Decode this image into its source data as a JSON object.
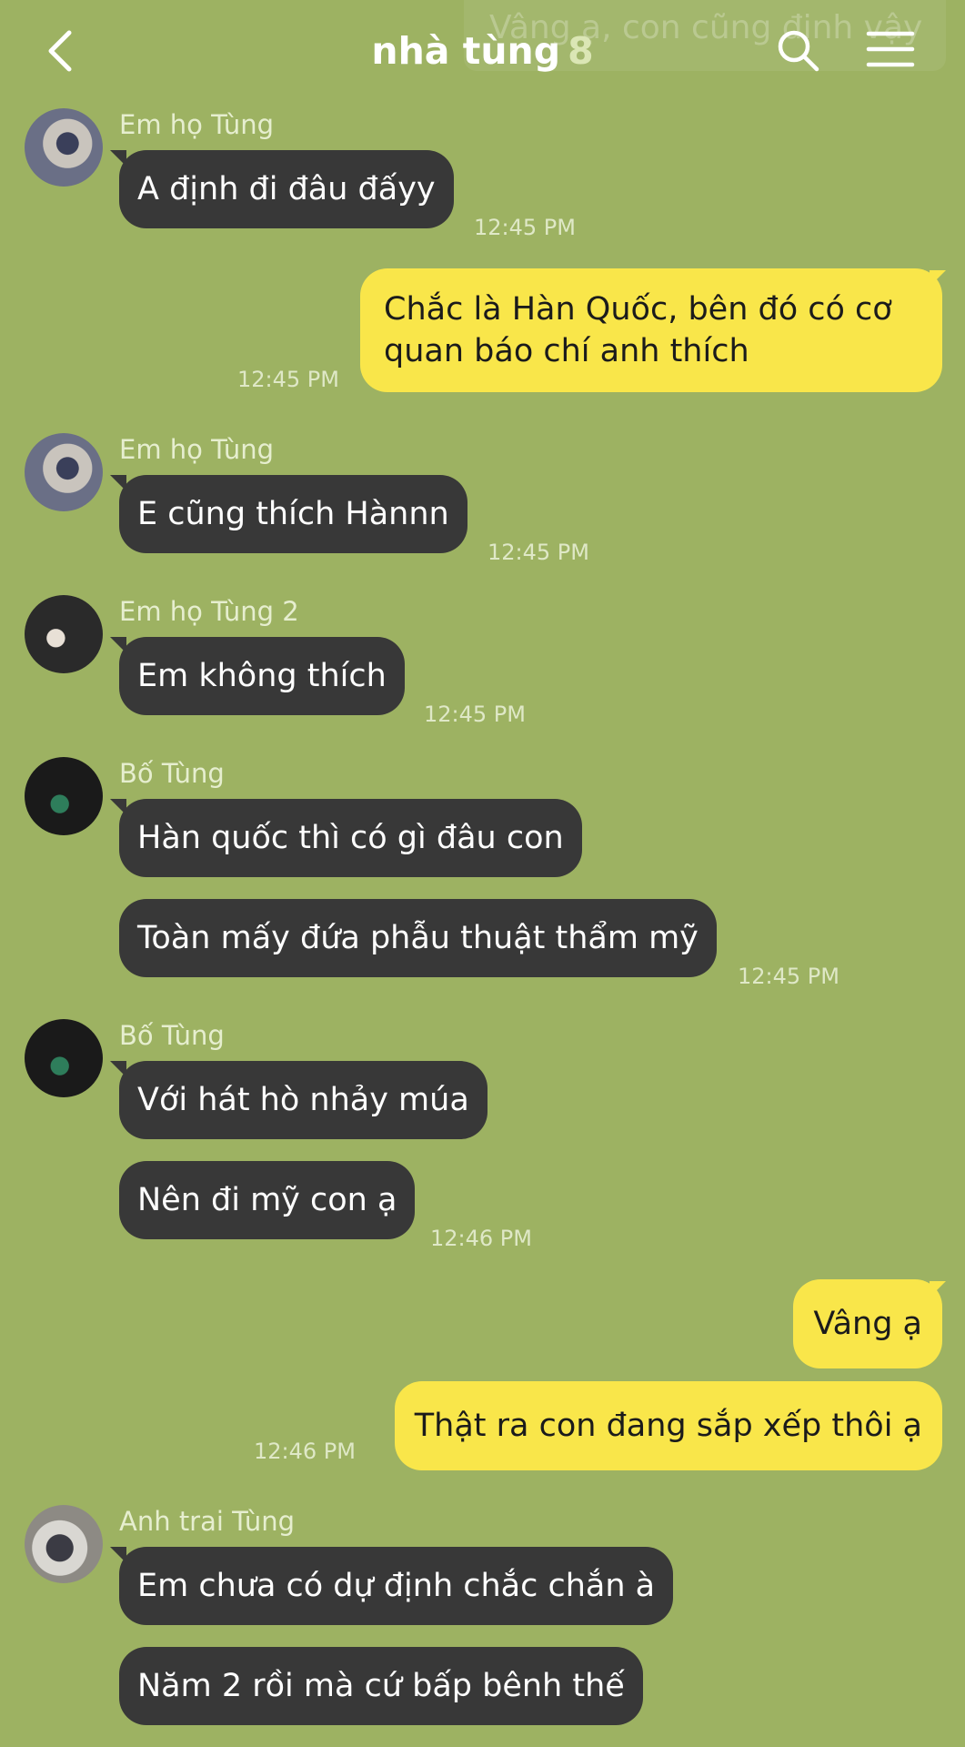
{
  "header": {
    "title": "nhà tùng",
    "member_count": "8",
    "notification_preview": "Vâng ạ, con cũng định vậy"
  },
  "messages": [
    {
      "sender": "Em họ Tùng",
      "text": "A định đi đâu đấyy",
      "time": "12:45 PM"
    },
    {
      "text": "Chắc là Hàn Quốc, bên đó có cơ quan báo chí anh thích",
      "time": "12:45 PM"
    },
    {
      "sender": "Em họ Tùng",
      "text": "E cũng thích Hànnn",
      "time": "12:45 PM"
    },
    {
      "sender": "Em họ Tùng 2",
      "text": "Em không thích",
      "time": "12:45 PM"
    },
    {
      "sender": "Bố Tùng",
      "text": "Hàn quốc thì có gì đâu con"
    },
    {
      "text": "Toàn mấy đứa phẫu thuật thẩm mỹ",
      "time": "12:45 PM"
    },
    {
      "sender": "Bố Tùng",
      "text": "Với hát hò nhảy múa"
    },
    {
      "text": "Nên đi mỹ con ạ",
      "time": "12:46 PM"
    },
    {
      "text": "Vâng ạ"
    },
    {
      "text": "Thật ra con đang sắp xếp thôi ạ",
      "time": "12:46 PM"
    },
    {
      "sender": "Anh trai Tùng",
      "text": "Em chưa có dự định chắc chắn à"
    },
    {
      "text": "Năm 2 rồi mà cứ bấp bênh thế"
    }
  ],
  "colors": {
    "background": "#9db262",
    "incoming_bubble": "#383838",
    "outgoing_bubble": "#f9e64a"
  },
  "icons": [
    "back-arrow-icon",
    "search-icon",
    "menu-icon"
  ]
}
